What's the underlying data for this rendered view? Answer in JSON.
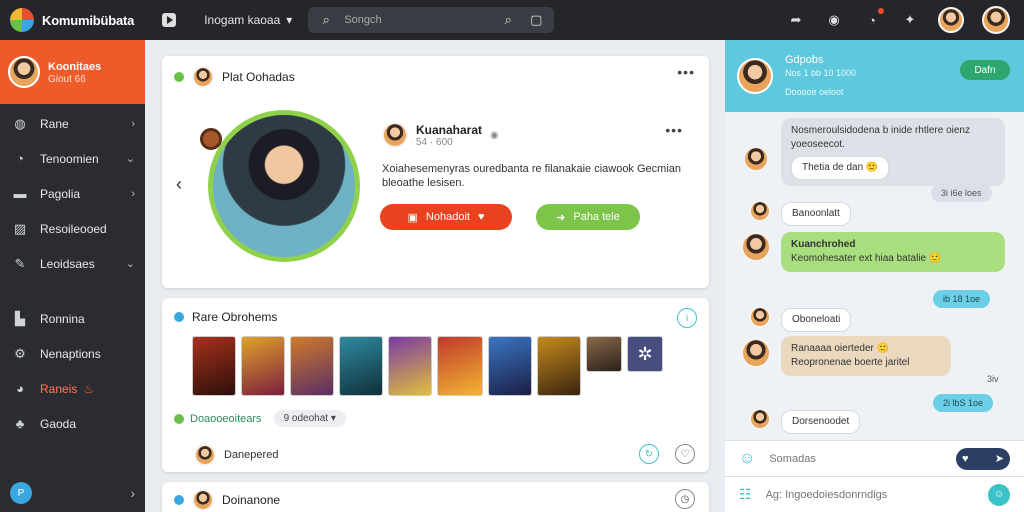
{
  "colors": {
    "accent": "#ef5a2b",
    "chat_header": "#5ec8dd",
    "success": "#7cc44a",
    "sidebar": "#2a2c31"
  },
  "topbar": {
    "app_title": "Komumibübata",
    "menu_label": "Inogam kaoaa",
    "search_placeholder": "Songch"
  },
  "sidebar": {
    "profile": {
      "name": "Koonitaes",
      "sub": "Giout 66"
    },
    "items": [
      {
        "label": "Rane",
        "icon": "globe-icon",
        "chevron": true
      },
      {
        "label": "Tenoomien",
        "icon": "clock-icon",
        "chevron": true
      },
      {
        "label": "Pagolia",
        "icon": "folder-icon",
        "chevron": true
      },
      {
        "label": "Resoileooed",
        "icon": "image-icon",
        "chevron": false
      },
      {
        "label": "Leoidsaes",
        "icon": "pen-icon",
        "chevron": true
      },
      {
        "label": "Ronnina",
        "icon": "bookmark-icon",
        "chevron": false
      },
      {
        "label": "Nenaptions",
        "icon": "settings-icon",
        "chevron": false
      },
      {
        "label": "Raneis",
        "icon": "fire-icon",
        "chevron": false
      },
      {
        "label": "Gaoda",
        "icon": "users-icon",
        "chevron": false
      }
    ]
  },
  "feed": {
    "post": {
      "header": "Plat Oohadas",
      "author": "Kuanaharat",
      "author_meta": "54 · 600",
      "text": "Xoiahesemenyras ouredbanta re filanakaie ciawook Gecmian bleoathe lesisen.",
      "primary_label": "Nohadoit",
      "secondary_label": "Paha tele"
    },
    "gallery": {
      "header": "Rare Obrohems",
      "tag": "Doaooeoitears",
      "pill": "9 odeohat",
      "item_label": "Danepered"
    },
    "third": {
      "header": "Doinanone"
    }
  },
  "chat": {
    "title": "Gdpobs",
    "subtitle": "Nos 1 bb 10 1000",
    "status": "Dooooe oeloot",
    "header_button": "Dafn",
    "messages": [
      {
        "text": "Nosmeroulsidodena b inide rhtlere oienz yoeoseecot.",
        "sub": "Thetia de dan 🙂",
        "style": "grey"
      },
      {
        "text": "3i i6e loes",
        "style": "time-grey"
      },
      {
        "text": "Banoonlatt",
        "style": "white"
      },
      {
        "text": "Kuanchrohed",
        "sub": "Keomohesater ext hiaa batalie 🙂",
        "style": "green"
      },
      {
        "text": "ib 18 1oe",
        "style": "time"
      },
      {
        "text": "Oboneloati",
        "style": "white"
      },
      {
        "text": "Ranaaaa oierteder 🙂",
        "sub": "Reopronenae boerte jaritel",
        "style": "beige"
      },
      {
        "text": "3iv",
        "style": "plain"
      },
      {
        "text": "2i lbS 1oe",
        "style": "time"
      },
      {
        "text": "Dorsenoodet",
        "style": "white"
      }
    ],
    "compose_placeholder": "Somadas",
    "message_placeholder": "Ag: Ingoedoiesdonrndigs"
  }
}
